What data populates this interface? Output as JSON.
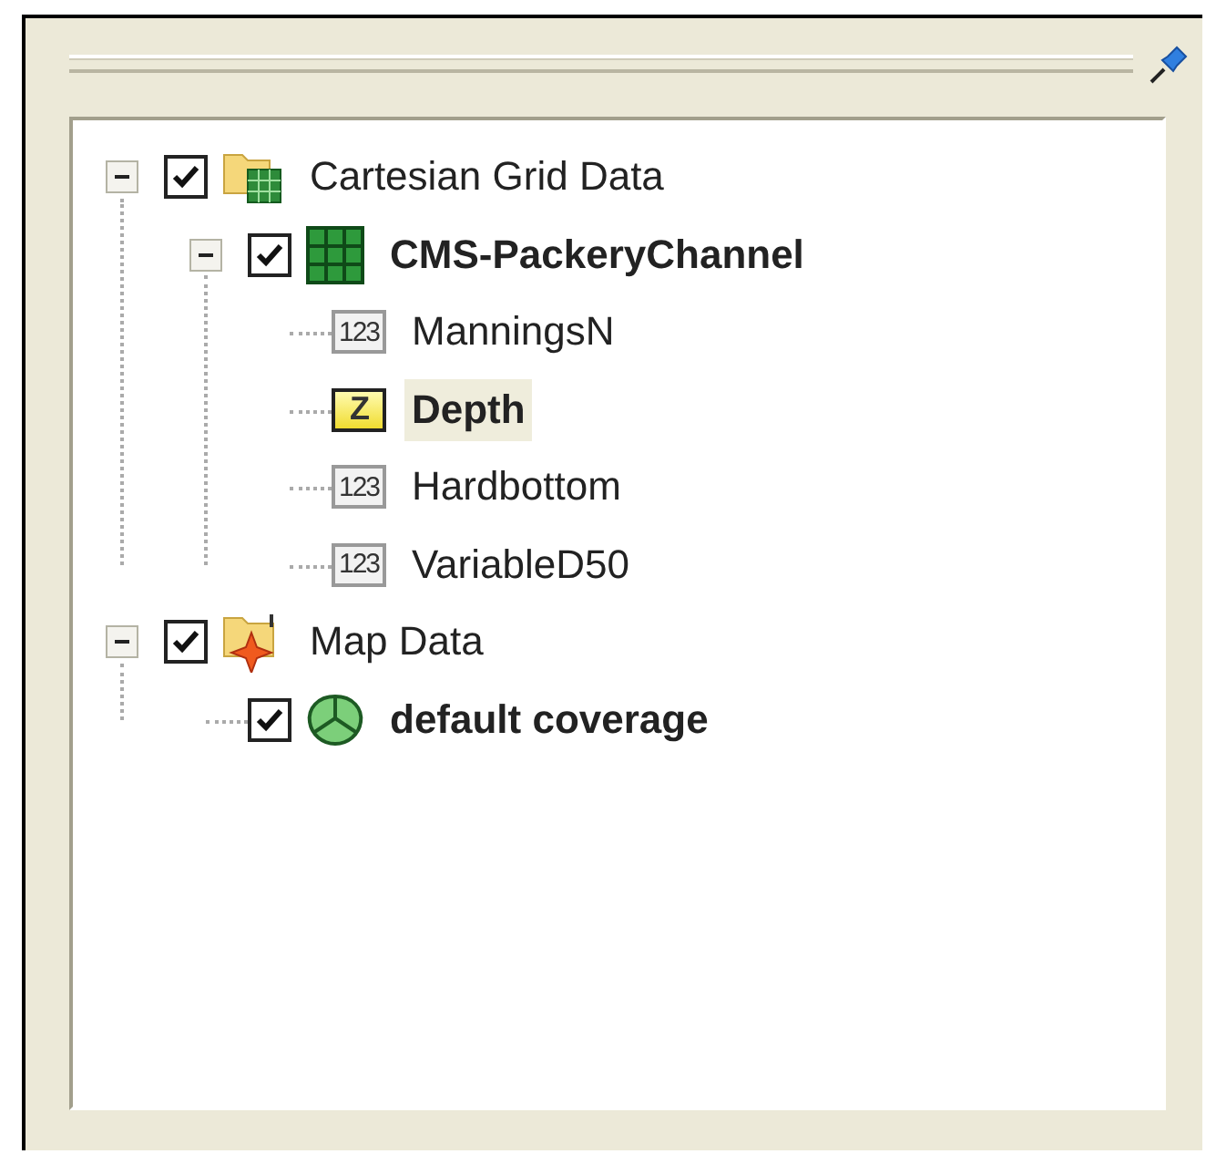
{
  "tree": [
    {
      "label": "Cartesian Grid Data",
      "kind": "grid_folder",
      "checked": true,
      "expanded": true,
      "active": false,
      "selected": false,
      "children": [
        {
          "label": "CMS-PackeryChannel",
          "kind": "grid",
          "checked": true,
          "expanded": true,
          "active": true,
          "selected": false,
          "children": [
            {
              "label": "ManningsN",
              "kind": "dataset",
              "badge": "123",
              "active": false,
              "selected": false
            },
            {
              "label": "Depth",
              "kind": "elevation",
              "badge": "Z",
              "active": true,
              "selected": true
            },
            {
              "label": "Hardbottom",
              "kind": "dataset",
              "badge": "123",
              "active": false,
              "selected": false
            },
            {
              "label": "VariableD50",
              "kind": "dataset",
              "badge": "123",
              "active": false,
              "selected": false
            }
          ]
        }
      ]
    },
    {
      "label": "Map Data",
      "kind": "map_folder",
      "checked": true,
      "expanded": true,
      "active": false,
      "selected": false,
      "children": [
        {
          "label": "default coverage",
          "kind": "coverage",
          "checked": true,
          "active": true,
          "selected": false
        }
      ]
    }
  ]
}
